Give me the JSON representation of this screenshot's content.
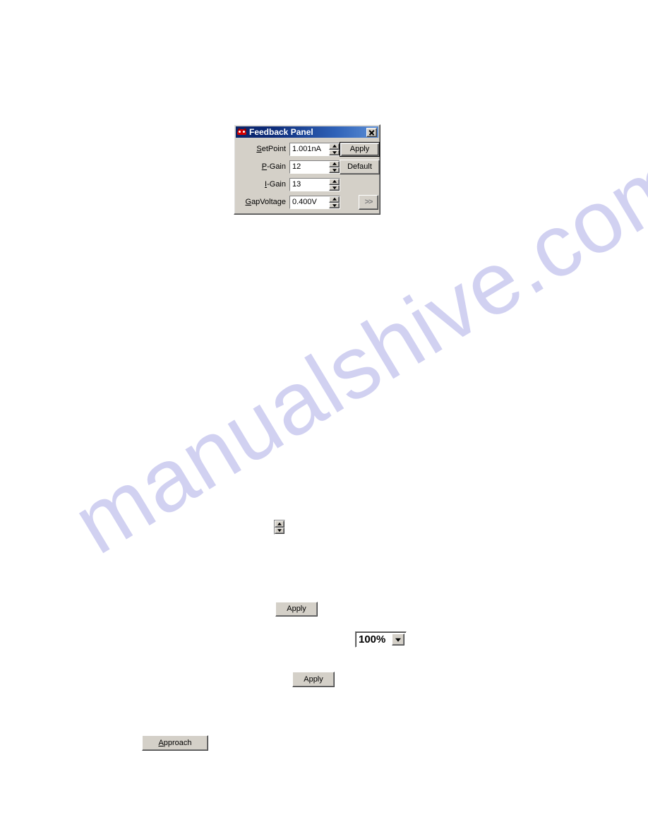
{
  "page": {
    "background_color": "#ffffff",
    "watermark": {
      "text": "manualshive.com",
      "color": "#c9c9ef"
    }
  },
  "dialog": {
    "title": "Feedback Panel",
    "icon": "red-mask-icon",
    "close_label": "✕",
    "titlebar_color_left": "#0a246a",
    "titlebar_color_right": "#5b8ed6",
    "body_color": "#d4d0c8",
    "fields": [
      {
        "label_prefix": "S",
        "label_rest": "etPoint",
        "value": "1.001nA"
      },
      {
        "label_prefix": "P",
        "label_rest": "-Gain",
        "value": "12"
      },
      {
        "label_prefix": "I",
        "label_rest": "-Gain",
        "value": "13"
      },
      {
        "label_prefix": "G",
        "label_rest": "apVoltage",
        "value": "0.400V"
      }
    ],
    "buttons": {
      "apply": "Apply",
      "default": "Default",
      "more": ">>"
    }
  },
  "standalone": {
    "spinner_name": "spinner-control",
    "apply_1": "Apply",
    "apply_2": "Apply",
    "approach_prefix": "A",
    "approach_rest": "pproach",
    "zoom_combo_value": "100%"
  }
}
